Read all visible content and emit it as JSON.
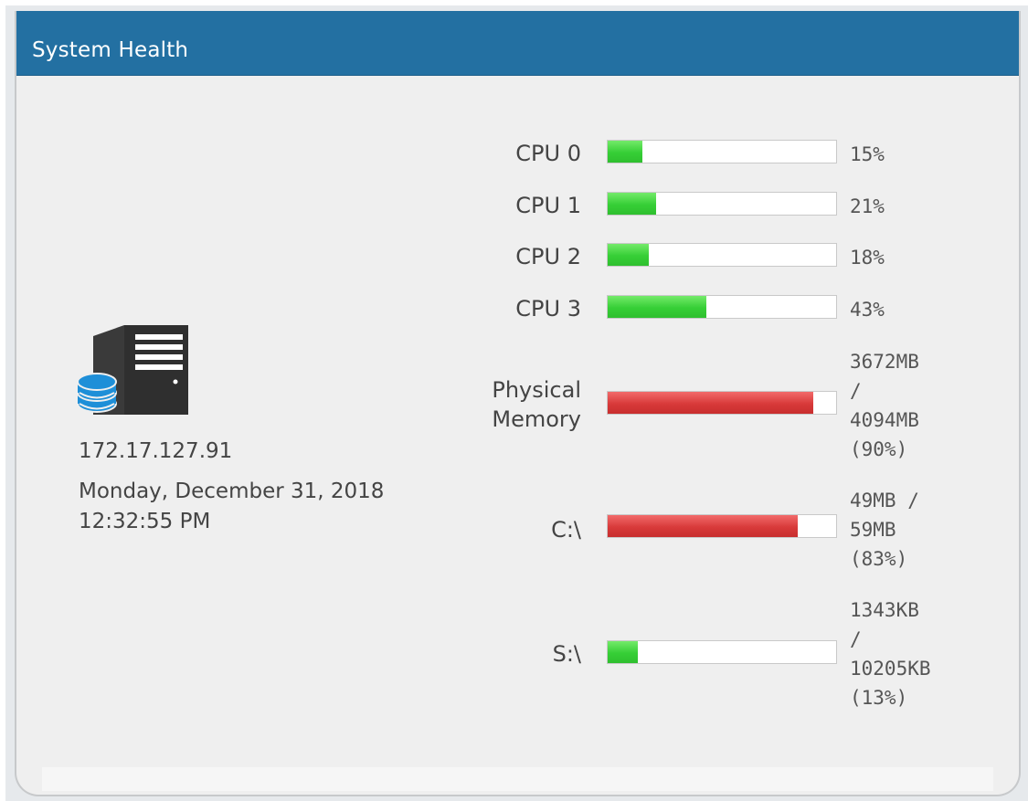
{
  "panel": {
    "title": "System Health"
  },
  "host": {
    "icon": "server-database-icon",
    "ip": "172.17.127.91",
    "datetime": "Monday, December 31, 2018 12:32:55 PM"
  },
  "colors": {
    "header": "#2370a2",
    "ok": "#36cf36",
    "warn": "#d83a3a"
  },
  "metrics": [
    {
      "label": "CPU 0",
      "value": "15%",
      "percent": 15,
      "status": "ok"
    },
    {
      "label": "CPU 1",
      "value": "21%",
      "percent": 21,
      "status": "ok"
    },
    {
      "label": "CPU 2",
      "value": "18%",
      "percent": 18,
      "status": "ok"
    },
    {
      "label": "CPU 3",
      "value": "43%",
      "percent": 43,
      "status": "ok"
    },
    {
      "label": "Physical\nMemory",
      "value": "3672MB\n/\n4094MB\n(90%)",
      "percent": 90,
      "status": "warn"
    },
    {
      "label": "C:\\",
      "value": "49MB /\n59MB\n(83%)",
      "percent": 83,
      "status": "warn"
    },
    {
      "label": "S:\\",
      "value": "1343KB\n/\n10205KB\n(13%)",
      "percent": 13,
      "status": "ok"
    }
  ]
}
